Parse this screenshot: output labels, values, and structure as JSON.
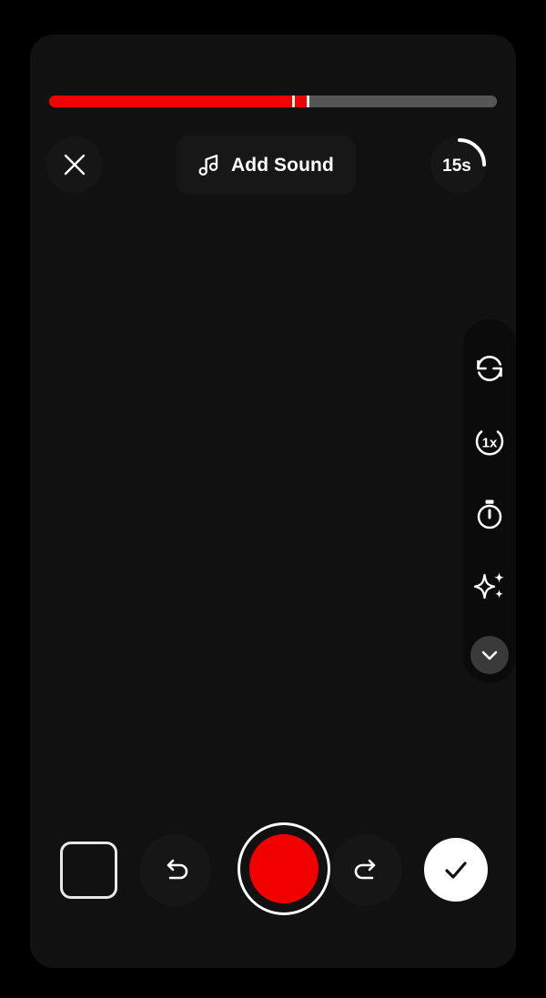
{
  "app": {
    "screen_name": "Video Recorder",
    "background_color": "#000000",
    "panel_color": "#111111",
    "accent_color": "#f20000"
  },
  "progress": {
    "name": "recording-progress",
    "total_segments_color_recorded": "#f20000",
    "track_color": "#565656",
    "divider_color": "#f2f2f2",
    "segments": [
      {
        "type": "recorded",
        "percent": 54.3
      },
      {
        "type": "divider",
        "percent": 0.6
      },
      {
        "type": "recorded",
        "percent": 2.7
      },
      {
        "type": "divider",
        "percent": 0.6
      },
      {
        "type": "remaining",
        "percent": 41.8
      }
    ]
  },
  "top_bar": {
    "close_label": "Close",
    "close_icon": "close-icon",
    "add_sound": {
      "label": "Add Sound",
      "icon": "music-note-icon"
    },
    "timer": {
      "label": "15s",
      "arc_percent": 25,
      "arc_color": "#ffffff"
    }
  },
  "tool_rail": {
    "items": [
      {
        "name": "flip-camera",
        "icon": "rotate-camera-icon",
        "label": "Flip camera"
      },
      {
        "name": "speed",
        "icon": "speed-1x-icon",
        "label": "1x"
      },
      {
        "name": "timer",
        "icon": "stopwatch-icon",
        "label": "Timer"
      },
      {
        "name": "effects",
        "icon": "sparkles-icon",
        "label": "Effects"
      }
    ],
    "collapse": {
      "icon": "chevron-down-icon",
      "label": "Collapse tools",
      "background": "#3a3a3a"
    }
  },
  "bottom_bar": {
    "gallery": {
      "label": "Gallery",
      "icon": "gallery-square-icon"
    },
    "undo": {
      "label": "Undo",
      "icon": "undo-arrow-icon"
    },
    "record": {
      "label": "Record",
      "icon": "record-circle-icon",
      "color": "#f20000"
    },
    "redo": {
      "label": "Redo",
      "icon": "redo-arrow-icon"
    },
    "confirm": {
      "label": "Confirm",
      "icon": "check-icon"
    }
  }
}
